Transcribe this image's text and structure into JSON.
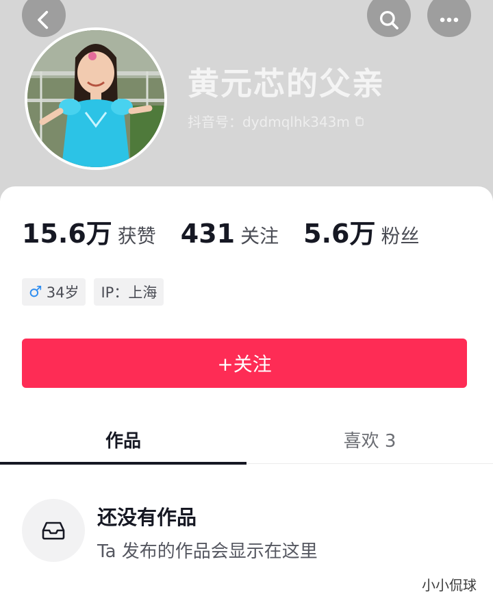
{
  "header": {
    "back_icon": "chevron-left-icon",
    "search_icon": "search-icon",
    "more_icon": "more-dots-icon"
  },
  "profile": {
    "display_name": "黄元芯的父亲",
    "douyin_id": "抖音号：dydmqlhk343m",
    "avatar": "child-photo-avatar"
  },
  "stats": [
    {
      "value": "15.6万",
      "label": "获赞"
    },
    {
      "value": "431",
      "label": "关注"
    },
    {
      "value": "5.6万",
      "label": "粉丝"
    }
  ],
  "tags": {
    "gender_icon": "♂",
    "age": "34岁",
    "ip": "IP：上海"
  },
  "follow_button": "+关注",
  "tabs": [
    {
      "label": "作品",
      "active": true
    },
    {
      "label": "喜欢 3",
      "active": false
    }
  ],
  "empty_state": {
    "icon": "inbox-tray-icon",
    "title": "还没有作品",
    "subtitle": "Ta 发布的作品会显示在这里"
  },
  "watermark": "小小侃球",
  "colors": {
    "accent": "#fe2c55",
    "header_bg": "#d6d6d6",
    "male": "#2d8cf0"
  }
}
